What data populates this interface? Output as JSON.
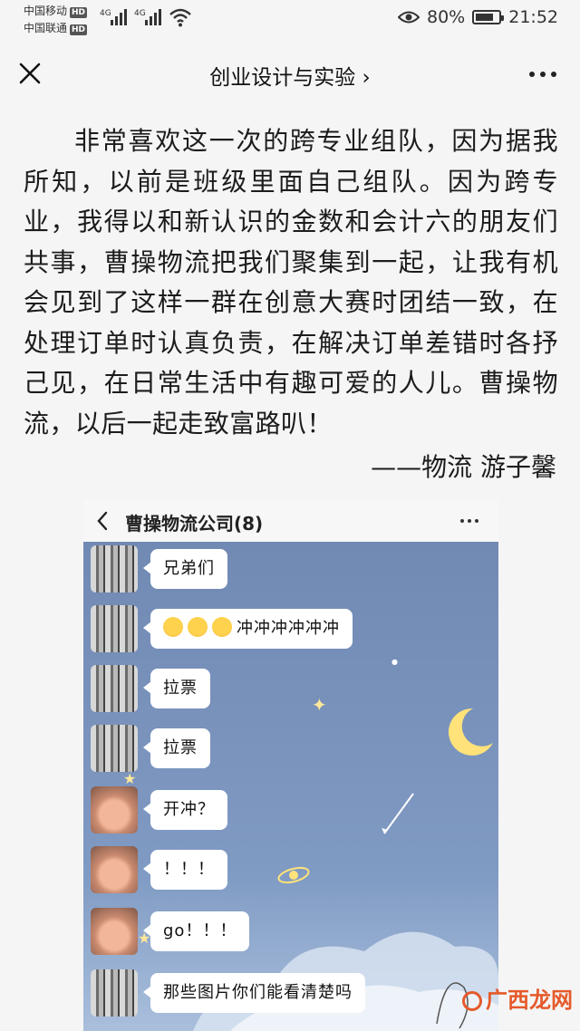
{
  "status_bar": {
    "carrier_1": "中国移动",
    "carrier_2": "中国联通",
    "hd_badge": "HD",
    "network_1": "4G",
    "network_2": "4G",
    "battery_percent": "80%",
    "battery_level": 0.8,
    "time": "21:52"
  },
  "navbar": {
    "title": "创业设计与实验",
    "chevron": "›"
  },
  "article": {
    "body": "非常喜欢这一次的跨专业组队，因为据我所知，以前是班级里面自己组队。因为跨专业，我得以和新认识的金数和会计六的朋友们共事，曹操物流把我们聚集到一起，让我有机会见到了这样一群在创意大赛时团结一致，在处理订单时认真负责，在解决订单差错时各抒己见，在日常生活中有趣可爱的人儿。曹操物流，以后一起走致富路叭！",
    "signature": "——物流 游子馨"
  },
  "chat_screenshot": {
    "header": {
      "back": "‹",
      "title": "曹操物流公司(8)"
    },
    "messages": [
      {
        "avatar": "a1",
        "text": "兄弟们"
      },
      {
        "avatar": "a1",
        "emoji_count": 3,
        "text": "冲冲冲冲冲冲"
      },
      {
        "avatar": "a1",
        "text": "拉票"
      },
      {
        "avatar": "a1",
        "text": "拉票"
      },
      {
        "avatar": "a2",
        "text": "开冲？"
      },
      {
        "avatar": "a2",
        "text": "！！！"
      },
      {
        "avatar": "a2",
        "text": "go！！！"
      },
      {
        "avatar": "a1",
        "text": "那些图片你们能看清楚吗"
      }
    ]
  },
  "watermark": {
    "text": "广西龙网"
  },
  "colors": {
    "sky_top": "#6f88b2",
    "sky_bottom": "#a9bfdc",
    "watermark": "#e55a2b"
  }
}
